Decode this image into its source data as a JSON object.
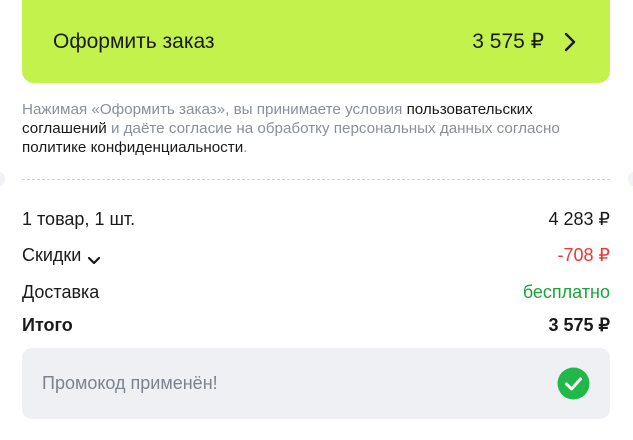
{
  "checkout": {
    "label": "Оформить заказ",
    "price": "3 575 ₽",
    "color": "#c3f24c"
  },
  "agreement": {
    "text_1": "Нажимая «Оформить заказ», вы принимаете условия ",
    "link_1": "пользовательских соглашений",
    "text_2": " и даёте согласие на обработку персональных данных согласно ",
    "link_2": "политике конфиденциальности",
    "text_3": "."
  },
  "summary": {
    "items_label": "1 товар, 1 шт.",
    "items_value": "4 283 ₽",
    "discounts_label": "Скидки",
    "discounts_value": "-708 ₽",
    "delivery_label": "Доставка",
    "delivery_value": "бесплатно",
    "total_label": "Итого",
    "total_value": "3 575 ₽"
  },
  "promo": {
    "text": "Промокод применён!",
    "status_icon": "check-circle-icon",
    "status_color": "#21b849"
  },
  "icons": {
    "checkout_arrow": "chevron-right-icon",
    "discounts_toggle": "chevron-down-icon"
  }
}
